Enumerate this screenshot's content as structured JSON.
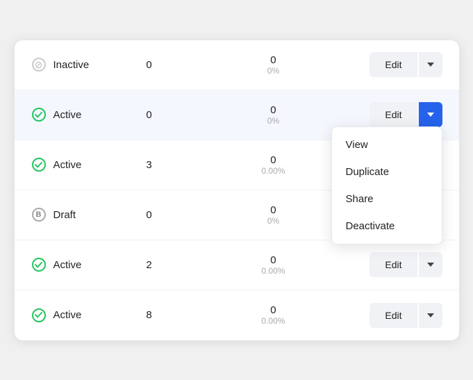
{
  "rows": [
    {
      "id": "row-inactive",
      "status": "Inactive",
      "statusType": "inactive",
      "num1": "0",
      "num2": "0",
      "pct": "0%",
      "editLabel": "Edit",
      "dropdownOpen": false,
      "highlighted": false
    },
    {
      "id": "row-active-1",
      "status": "Active",
      "statusType": "active",
      "num1": "0",
      "num2": "0",
      "pct": "0%",
      "editLabel": "Edit",
      "dropdownOpen": true,
      "highlighted": true
    },
    {
      "id": "row-active-2",
      "status": "Active",
      "statusType": "active",
      "num1": "3",
      "num2": "0",
      "pct": "0.00%",
      "editLabel": "Edit",
      "dropdownOpen": false,
      "highlighted": false
    },
    {
      "id": "row-draft",
      "status": "Draft",
      "statusType": "draft",
      "num1": "0",
      "num2": "0",
      "pct": "0%",
      "editLabel": "Edit",
      "dropdownOpen": false,
      "highlighted": false
    },
    {
      "id": "row-active-3",
      "status": "Active",
      "statusType": "active",
      "num1": "2",
      "num2": "0",
      "pct": "0.00%",
      "editLabel": "Edit",
      "dropdownOpen": false,
      "highlighted": false
    },
    {
      "id": "row-active-4",
      "status": "Active",
      "statusType": "active",
      "num1": "8",
      "num2": "0",
      "pct": "0.00%",
      "editLabel": "Edit",
      "dropdownOpen": false,
      "highlighted": false
    }
  ],
  "dropdown": {
    "items": [
      "View",
      "Duplicate",
      "Share",
      "Deactivate"
    ]
  }
}
